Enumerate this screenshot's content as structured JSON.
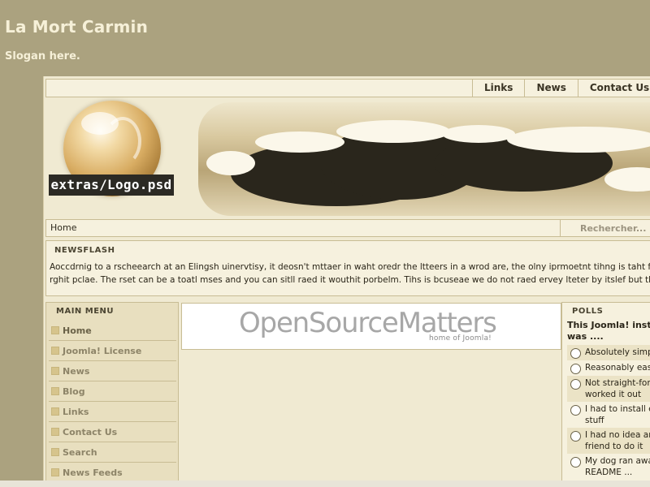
{
  "site": {
    "title": "La Mort Carmin",
    "slogan": "Slogan here."
  },
  "topnav": {
    "links": [
      "Links",
      "News",
      "Contact Us"
    ]
  },
  "header": {
    "logo_text": "extras/Logo.psd"
  },
  "pathway": {
    "crumb": "Home",
    "search_placeholder": "Rechercher..."
  },
  "newsflash": {
    "title": "NEWSFLASH",
    "line1": "Aoccdrnig to a rscheearch at an Elingsh uinervtisy, it deosn't mttaer in waht oredr the ltteers in a wrod are, the olny iprmoetnt tihng is taht frist and lsat ltte",
    "line2": "rghit pclae. The rset can be a toatl mses and you can sitll raed it wouthit porbelm. Tihs is bcuseae we do not raed ervey lteter by itslef but the wrod as a w"
  },
  "main_menu": {
    "title": "MAIN MENU",
    "items": [
      "Home",
      "Joomla! License",
      "News",
      "Blog",
      "Links",
      "Contact Us",
      "Search",
      "News Feeds"
    ]
  },
  "ad": {
    "logo": "OpenSourceMatters",
    "tagline": "home of Joomla!"
  },
  "polls": {
    "title": "POLLS",
    "question_l1": "This Joomla! instal",
    "question_l2": "was ....",
    "options": [
      {
        "l1": "Absolutely simpl",
        "l2": ""
      },
      {
        "l1": "Reasonably eas",
        "l2": ""
      },
      {
        "l1": "Not straight-forw",
        "l2": "worked it out"
      },
      {
        "l1": "I had to install ex",
        "l2": "stuff"
      },
      {
        "l1": "I had no idea and",
        "l2": "friend to do it"
      },
      {
        "l1": "My dog ran awa",
        "l2": "README ..."
      }
    ]
  },
  "colors": {
    "page_bg": "#aba27f",
    "panel_bg": "#f0ead2",
    "border": "#c8bc94",
    "title_text": "#f6f0d8"
  }
}
